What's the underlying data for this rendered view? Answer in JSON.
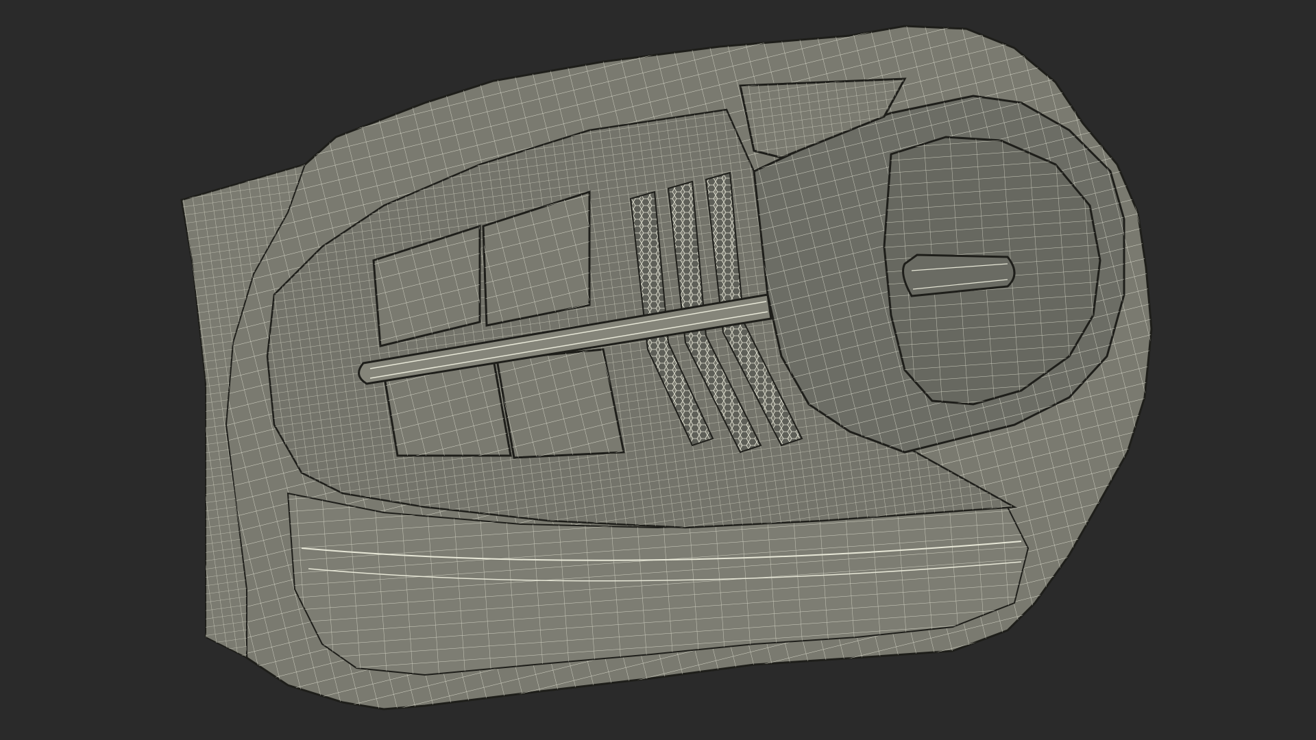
{
  "viewport": {
    "background_color": "#2a2a2a",
    "mesh_fill_color": "#7a7a70",
    "mesh_dark_fill_color": "#676860",
    "wire_color": "#e8e8d8",
    "edge_color": "#1e1e1a",
    "render_mode": "wireframe-on-shaded"
  }
}
